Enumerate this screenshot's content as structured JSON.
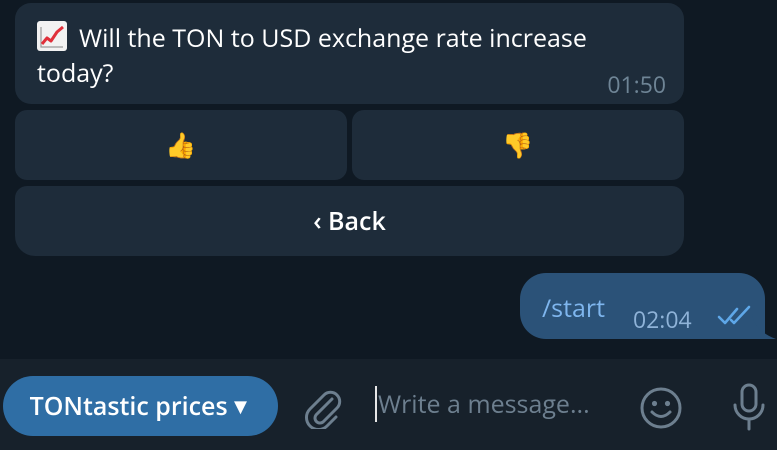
{
  "message_in": {
    "icon": "chart-increasing-emoji",
    "text": "Will the TON to USD exchange rate increase today?",
    "time": "01:50"
  },
  "keyboard": {
    "thumbs_up": "👍",
    "thumbs_down": "👎",
    "back_label": "‹ Back"
  },
  "message_out": {
    "text": "/start",
    "time": "02:04",
    "status_icon": "double-check-icon"
  },
  "composer": {
    "bot_button_label": "TONtastic prices",
    "bot_button_caret": "▼",
    "placeholder": "Write a message..."
  },
  "colors": {
    "background": "#0f1923",
    "bubble_in": "#1e2c3a",
    "bubble_out": "#2b5278",
    "accent": "#2f6ea5",
    "composer_bg": "#17212b"
  }
}
